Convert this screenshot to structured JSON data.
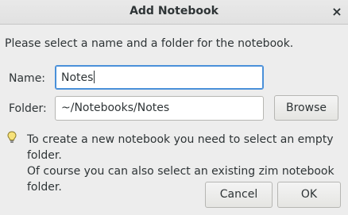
{
  "window": {
    "title": "Add Notebook",
    "close_glyph": "×"
  },
  "intro_text": "Please select a name and a folder for the notebook.",
  "form": {
    "name_label": "Name:",
    "name_value": "Notes",
    "folder_label": "Folder:",
    "folder_value": "~/Notebooks/Notes",
    "browse_label": "Browse"
  },
  "hint": {
    "icon": "lightbulb-icon",
    "line1": "To create a new notebook you need to select an empty folder.",
    "line2": "Of course you can also select an existing zim notebook folder."
  },
  "buttons": {
    "cancel_label": "Cancel",
    "ok_label": "OK"
  },
  "colors": {
    "focus_border": "#4a90d9",
    "background": "#ededed",
    "text": "#2e3436"
  }
}
